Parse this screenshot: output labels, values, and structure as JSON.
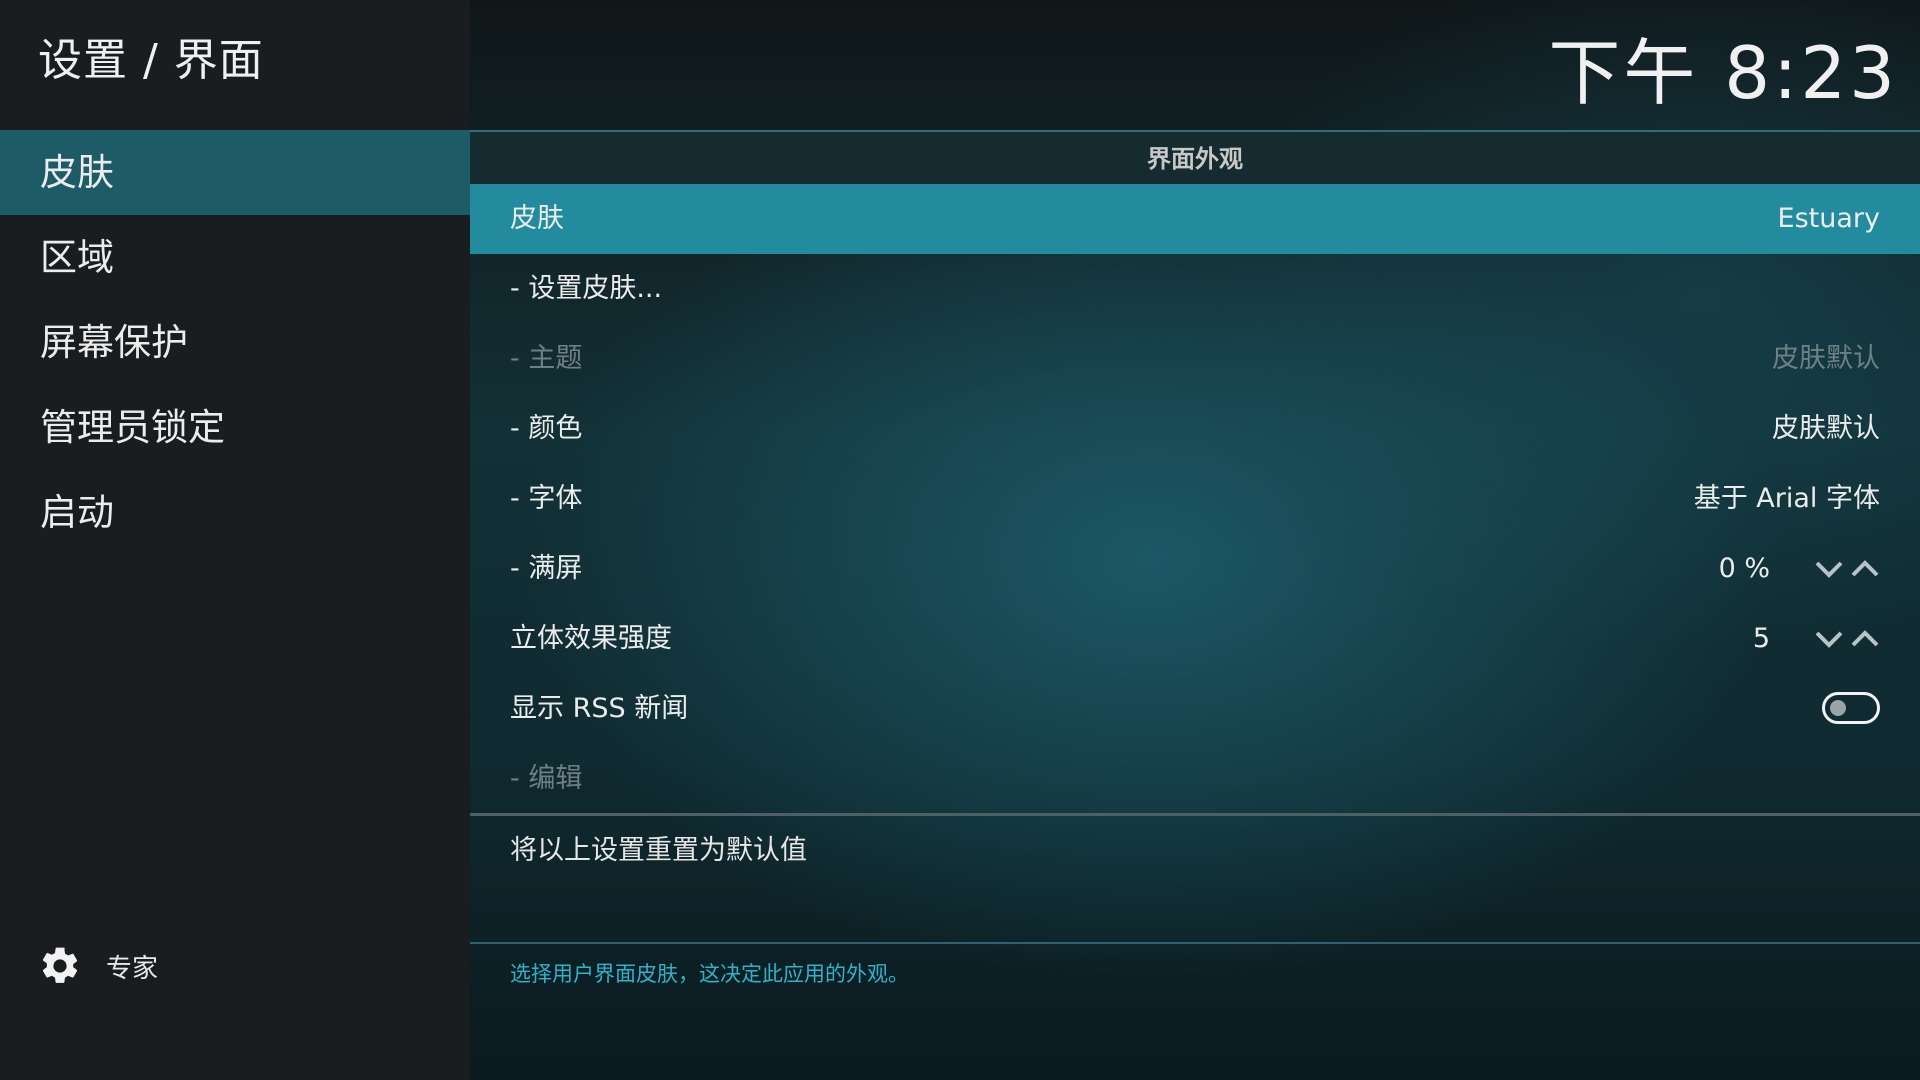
{
  "window": {
    "title": "设置 / 界面",
    "clock": "下午 8:23"
  },
  "sidebar": {
    "items": [
      {
        "label": "皮肤",
        "active": true
      },
      {
        "label": "区域"
      },
      {
        "label": "屏幕保护"
      },
      {
        "label": "管理员锁定"
      },
      {
        "label": "启动"
      }
    ],
    "level": {
      "icon": "gear-icon",
      "label": "专家"
    }
  },
  "main": {
    "group_title": "界面外观",
    "settings": [
      {
        "label": "皮肤",
        "value": "Estuary",
        "focused": true
      },
      {
        "label": "- 设置皮肤...",
        "value": ""
      },
      {
        "label": "- 主题",
        "value": "皮肤默认",
        "disabled": true
      },
      {
        "label": "- 颜色",
        "value": "皮肤默认"
      },
      {
        "label": "- 字体",
        "value": "基于 Arial 字体"
      },
      {
        "label": "- 满屏",
        "value": "0 %",
        "control": "spinner"
      },
      {
        "label": "立体效果强度",
        "value": "5",
        "control": "spinner"
      },
      {
        "label": "显示 RSS 新闻",
        "value": "",
        "control": "toggle",
        "state": "off"
      },
      {
        "label": "- 编辑",
        "value": "",
        "disabled": true
      }
    ],
    "reset_label": "将以上设置重置为默认值",
    "help_text": "选择用户界面皮肤，这决定此应用的外观。"
  },
  "colors": {
    "sidebar_bg": "#1a1d1f",
    "sidebar_active": "#1d5b66",
    "focused_row": "#228c9e",
    "help_text": "#2fb2cc"
  }
}
